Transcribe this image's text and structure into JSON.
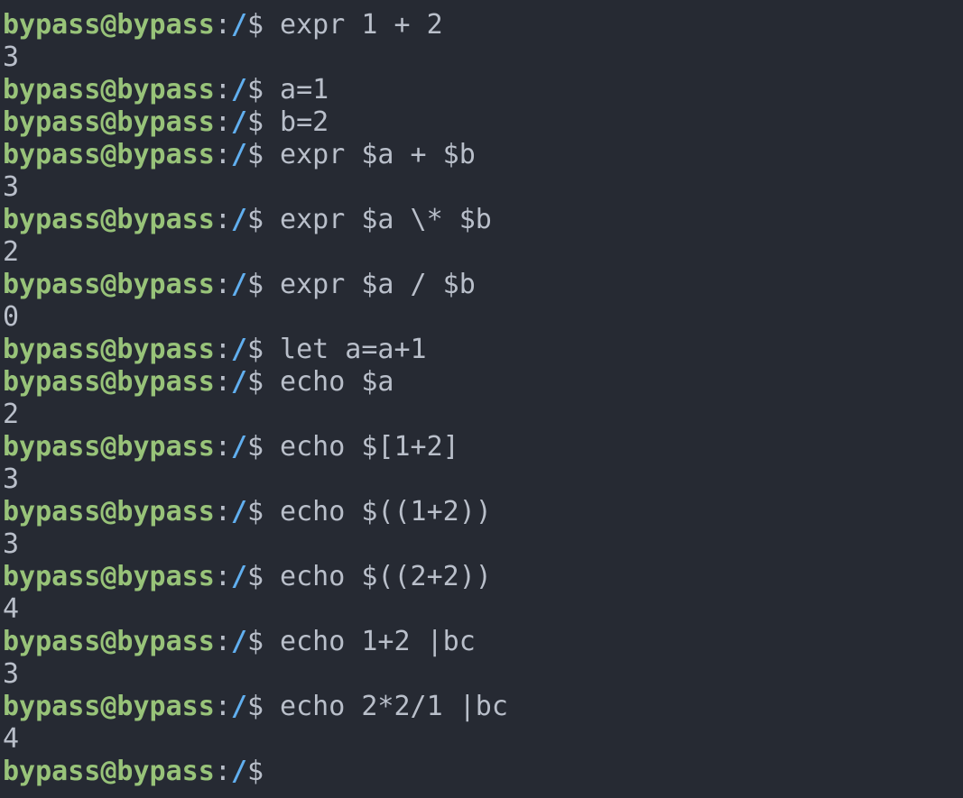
{
  "terminal": {
    "prompt": {
      "user_host": "bypass@bypass",
      "separator": ":",
      "path": "/",
      "symbol": "$"
    },
    "colors": {
      "background": "#262a33",
      "text": "#b9bfca",
      "user_host": "#98c379",
      "path": "#61afef"
    },
    "lines": [
      {
        "type": "prompt",
        "text": " expr 1 + 2"
      },
      {
        "type": "output",
        "text": "3"
      },
      {
        "type": "prompt",
        "text": " a=1"
      },
      {
        "type": "prompt",
        "text": " b=2"
      },
      {
        "type": "prompt",
        "text": " expr $a + $b"
      },
      {
        "type": "output",
        "text": "3"
      },
      {
        "type": "prompt",
        "text": " expr $a \\* $b"
      },
      {
        "type": "output",
        "text": "2"
      },
      {
        "type": "prompt",
        "text": " expr $a / $b"
      },
      {
        "type": "output",
        "text": "0"
      },
      {
        "type": "prompt",
        "text": " let a=a+1"
      },
      {
        "type": "prompt",
        "text": " echo $a"
      },
      {
        "type": "output",
        "text": "2"
      },
      {
        "type": "prompt",
        "text": " echo $[1+2]"
      },
      {
        "type": "output",
        "text": "3"
      },
      {
        "type": "prompt",
        "text": " echo $((1+2))"
      },
      {
        "type": "output",
        "text": "3"
      },
      {
        "type": "prompt",
        "text": " echo $((2+2))"
      },
      {
        "type": "output",
        "text": "4"
      },
      {
        "type": "prompt",
        "text": " echo 1+2 |bc"
      },
      {
        "type": "output",
        "text": "3"
      },
      {
        "type": "prompt",
        "text": " echo 2*2/1 |bc"
      },
      {
        "type": "output",
        "text": "4"
      },
      {
        "type": "prompt",
        "text": ""
      }
    ]
  }
}
